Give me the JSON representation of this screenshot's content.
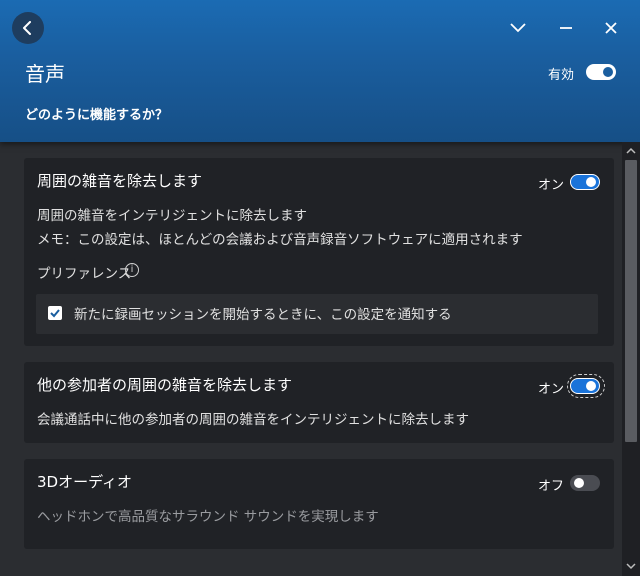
{
  "header": {
    "title": "音声",
    "subtitle": "どのように機能するか？",
    "enabled_label": "有効"
  },
  "cards": [
    {
      "title": "周囲の雑音を除去します",
      "state": "オン",
      "description": "周囲の雑音をインテリジェントに除去します",
      "note": "メモ：この設定は、ほとんどの会議および音声録音ソフトウェアに適用されます",
      "pref_label": "プリファレンス",
      "notify_label": "新たに録画セッションを開始するときに、この設定を通知する"
    },
    {
      "title": "他の参加者の周囲の雑音を除去します",
      "state": "オン",
      "description": "会議通話中に他の参加者の周囲の雑音をインテリジェントに除去します"
    },
    {
      "title": "3Dオーディオ",
      "state": "オフ",
      "description": "ヘッドホンで高品質なサラウンド サウンドを実現します"
    }
  ],
  "icons": {
    "back": "back-arrow-icon",
    "minimize_chevron": "chevron-down-icon",
    "minimize": "minimize-icon",
    "close": "close-icon",
    "info": "info-icon",
    "check": "checkmark-icon"
  },
  "colors": {
    "header": "#1a5e9f",
    "accent": "#1a73d9",
    "card": "#202226",
    "background": "#2b2d31"
  }
}
